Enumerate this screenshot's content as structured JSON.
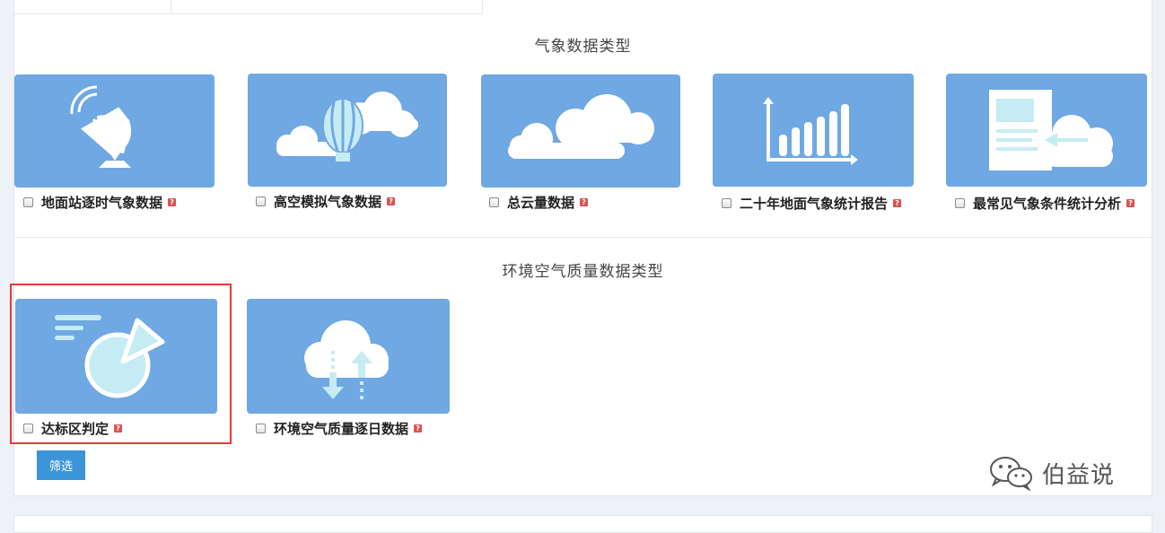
{
  "sections": [
    {
      "title": "气象数据类型",
      "items": [
        {
          "label": "地面站逐时气象数据",
          "icon": "satellite-dish-icon"
        },
        {
          "label": "高空模拟气象数据",
          "icon": "balloon-cloud-icon"
        },
        {
          "label": "总云量数据",
          "icon": "cloud-icon"
        },
        {
          "label": "二十年地面气象统计报告",
          "icon": "bar-chart-icon"
        },
        {
          "label": "最常见气象条件统计分析",
          "icon": "document-cloud-icon"
        }
      ]
    },
    {
      "title": "环境空气质量数据类型",
      "items": [
        {
          "label": "达标区判定",
          "icon": "pie-chart-icon"
        },
        {
          "label": "环境空气质量逐日数据",
          "icon": "cloud-transfer-icon"
        }
      ]
    }
  ],
  "help_mark": "?",
  "filter_button": "筛选",
  "watermark": "伯益说",
  "colors": {
    "card": "#6fa8e3",
    "icon_light": "#c6ecf3",
    "button": "#3c95d9",
    "highlight": "#e53935"
  }
}
